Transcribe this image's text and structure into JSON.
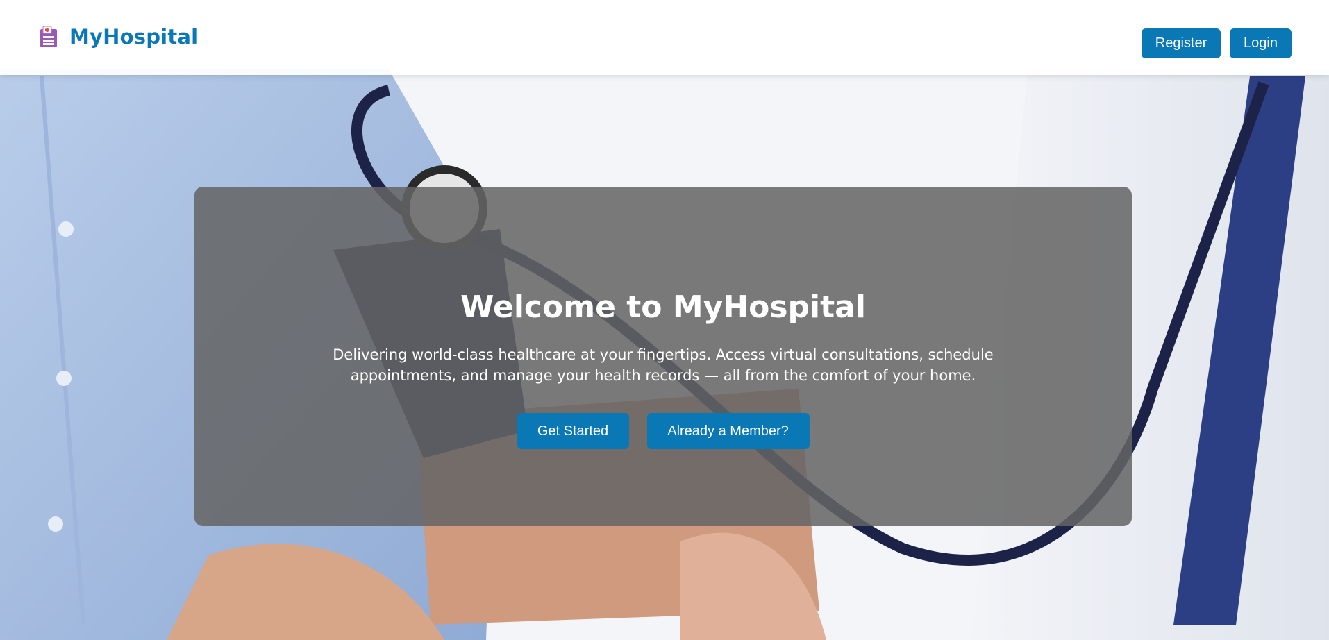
{
  "brand": {
    "name": "MyHospital",
    "icon": "hospital-icon"
  },
  "nav": {
    "register_label": "Register",
    "login_label": "Login"
  },
  "hero": {
    "title": "Welcome to MyHospital",
    "subtitle": "Delivering world-class healthcare at your fingertips. Access virtual consultations, schedule appointments, and manage your health records — all from the comfort of your home.",
    "primary_button": "Get Started",
    "secondary_button": "Already a Member?"
  },
  "colors": {
    "brand": "#0a78b8",
    "button": "#0b78b6",
    "hero_overlay": "#646464"
  }
}
